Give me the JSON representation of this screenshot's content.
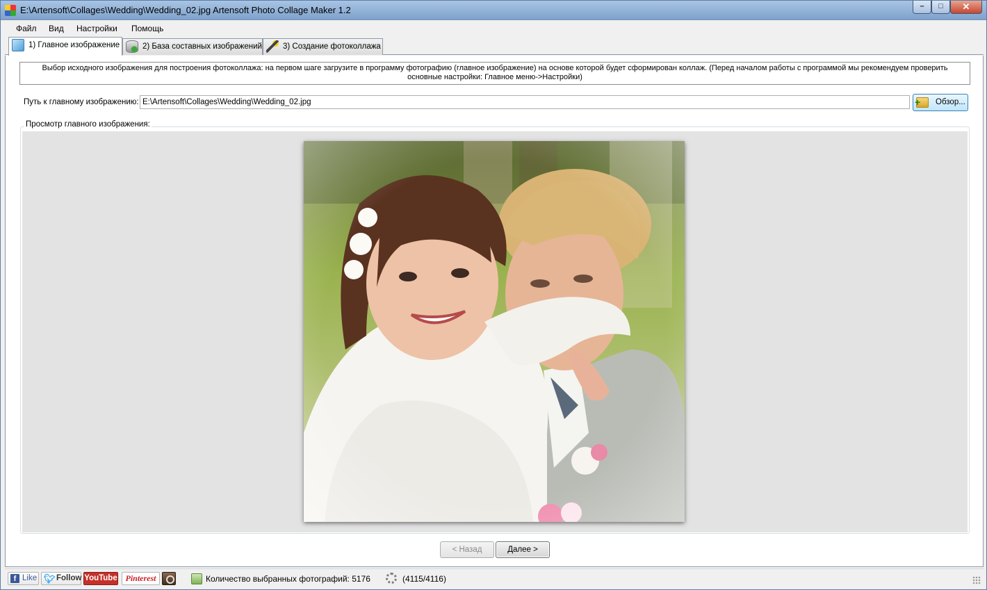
{
  "window": {
    "title": "E:\\Artensoft\\Collages\\Wedding\\Wedding_02.jpg Artensoft Photo Collage Maker 1.2",
    "controls": {
      "minimize": "–",
      "maximize": "□",
      "close": "✕"
    }
  },
  "menu": {
    "file": "Файл",
    "view": "Вид",
    "settings": "Настройки",
    "help": "Помощь"
  },
  "tabs": [
    {
      "label": "1) Главное изображение",
      "icon": "image-icon",
      "active": true
    },
    {
      "label": "2) База составных изображений",
      "icon": "database-add-icon",
      "active": false
    },
    {
      "label": "3) Создание фотоколлажа",
      "icon": "magic-wand-icon",
      "active": false
    }
  ],
  "step1": {
    "description": "Выбор исходного изображения для построения фотоколлажа: на первом шаге загрузите в программу фотографию (главное изображение) на основе которой будет сформирован коллаж. (Перед началом работы с программой мы рекомендуем проверить основные настройки: Главное меню->Настройки)",
    "path_label": "Путь к главному изображению:",
    "path_value": "E:\\Artensoft\\Collages\\Wedding\\Wedding_02.jpg",
    "browse_label": "Обзор...",
    "preview_label": "Просмотр главного изображения:"
  },
  "nav": {
    "back": "< Назад",
    "next": "Далее >"
  },
  "status": {
    "facebook": "Like",
    "twitter": "Follow",
    "youtube": "YouTube",
    "pinterest": "Pinterest",
    "instagram_icon": "instagram-icon",
    "photo_count": "Количество выбранных фотографий: 5176",
    "progress": "(4115/4116)"
  },
  "colors": {
    "titlebar": "#7ea2cc",
    "close_button": "#c7462f",
    "browse_button": "#bee6fd",
    "preview_background": "#e3e3e3"
  }
}
